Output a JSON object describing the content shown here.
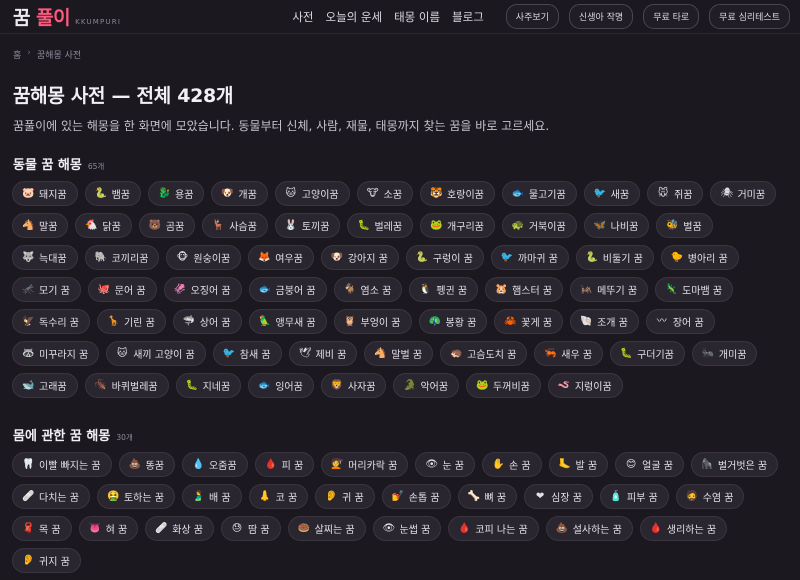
{
  "header": {
    "logo_text": "꿈",
    "logo_accent": "풀이",
    "logo_sub": "KKUMPURI",
    "links": [
      "사전",
      "오늘의 운세",
      "태몽 이름",
      "블로그"
    ],
    "buttons": [
      "사주보기",
      "신생아 작명",
      "무료 타로",
      "무료 심리테스트"
    ]
  },
  "breadcrumb": {
    "home": "홈",
    "sep": "›",
    "current": "꿈해몽 사전"
  },
  "page": {
    "title": "꿈해몽 사전 — 전체 428개",
    "description": "꿈풀이에 있는 해몽을 한 화면에 모았습니다. 동물부터 신체, 사람, 재물, 태몽까지 찾는 꿈을 바로 고르세요."
  },
  "sections": [
    {
      "title": "동물 꿈 해몽",
      "count": "65개",
      "items": [
        {
          "icon": "🐷",
          "label": "돼지꿈"
        },
        {
          "icon": "🐍",
          "label": "뱀꿈"
        },
        {
          "icon": "🐉",
          "label": "용꿈"
        },
        {
          "icon": "🐶",
          "label": "개꿈"
        },
        {
          "icon": "🐱",
          "label": "고양이꿈"
        },
        {
          "icon": "🐮",
          "label": "소꿈"
        },
        {
          "icon": "🐯",
          "label": "호랑이꿈"
        },
        {
          "icon": "🐟",
          "label": "물고기꿈"
        },
        {
          "icon": "🐦",
          "label": "새꿈"
        },
        {
          "icon": "🐭",
          "label": "쥐꿈"
        },
        {
          "icon": "🕷",
          "label": "거미꿈"
        },
        {
          "icon": "🐴",
          "label": "말꿈"
        },
        {
          "icon": "🐔",
          "label": "닭꿈"
        },
        {
          "icon": "🐻",
          "label": "곰꿈"
        },
        {
          "icon": "🦌",
          "label": "사슴꿈"
        },
        {
          "icon": "🐰",
          "label": "토끼꿈"
        },
        {
          "icon": "🐛",
          "label": "벌레꿈"
        },
        {
          "icon": "🐸",
          "label": "개구리꿈"
        },
        {
          "icon": "🐢",
          "label": "거북이꿈"
        },
        {
          "icon": "🦋",
          "label": "나비꿈"
        },
        {
          "icon": "🐝",
          "label": "벌꿈"
        },
        {
          "icon": "🐺",
          "label": "늑대꿈"
        },
        {
          "icon": "🐘",
          "label": "코끼리꿈"
        },
        {
          "icon": "🐵",
          "label": "원숭이꿈"
        },
        {
          "icon": "🦊",
          "label": "여우꿈"
        },
        {
          "icon": "🐶",
          "label": "강아지 꿈"
        },
        {
          "icon": "🐍",
          "label": "구렁이 꿈"
        },
        {
          "icon": "🐦",
          "label": "까마귀 꿈"
        },
        {
          "icon": "🐍",
          "label": "비둘기 꿈"
        },
        {
          "icon": "🐤",
          "label": "병아리 꿈"
        },
        {
          "icon": "🦟",
          "label": "모기 꿈"
        },
        {
          "icon": "🐙",
          "label": "문어 꿈"
        },
        {
          "icon": "🦑",
          "label": "오징어 꿈"
        },
        {
          "icon": "🐟",
          "label": "금붕어 꿈"
        },
        {
          "icon": "🐐",
          "label": "염소 꿈"
        },
        {
          "icon": "🐧",
          "label": "펭귄 꿈"
        },
        {
          "icon": "🐹",
          "label": "햄스터 꿈"
        },
        {
          "icon": "🦗",
          "label": "메뚜기 꿈"
        },
        {
          "icon": "🦎",
          "label": "도마뱀 꿈"
        },
        {
          "icon": "🦅",
          "label": "독수리 꿈"
        },
        {
          "icon": "🦒",
          "label": "기린 꿈"
        },
        {
          "icon": "🦈",
          "label": "상어 꿈"
        },
        {
          "icon": "🦜",
          "label": "앵무새 꿈"
        },
        {
          "icon": "🦉",
          "label": "부엉이 꿈"
        },
        {
          "icon": "🦚",
          "label": "봉황 꿈"
        },
        {
          "icon": "🦀",
          "label": "꽃게 꿈"
        },
        {
          "icon": "🐚",
          "label": "조개 꿈"
        },
        {
          "icon": "〰",
          "label": "장어 꿈"
        },
        {
          "icon": "🦝",
          "label": "미꾸라지 꿈"
        },
        {
          "icon": "🐱",
          "label": "새끼 고양이 꿈"
        },
        {
          "icon": "🐦",
          "label": "참새 꿈"
        },
        {
          "icon": "🕊",
          "label": "제비 꿈"
        },
        {
          "icon": "🐴",
          "label": "말벌 꿈"
        },
        {
          "icon": "🦔",
          "label": "고슴도치 꿈"
        },
        {
          "icon": "🦐",
          "label": "새우 꿈"
        },
        {
          "icon": "🐛",
          "label": "구더기꿈"
        },
        {
          "icon": "🐜",
          "label": "개미꿈"
        },
        {
          "icon": "🐋",
          "label": "고래꿈"
        },
        {
          "icon": "🪳",
          "label": "바퀴벌레꿈"
        },
        {
          "icon": "🐛",
          "label": "지네꿈"
        },
        {
          "icon": "🐟",
          "label": "잉어꿈"
        },
        {
          "icon": "🦁",
          "label": "사자꿈"
        },
        {
          "icon": "🐊",
          "label": "악어꿈"
        },
        {
          "icon": "🐸",
          "label": "두꺼비꿈"
        },
        {
          "icon": "🪱",
          "label": "지렁이꿈"
        }
      ]
    },
    {
      "title": "몸에 관한 꿈 해몽",
      "count": "30개",
      "items": [
        {
          "icon": "🦷",
          "label": "이빨 빠지는 꿈"
        },
        {
          "icon": "💩",
          "label": "똥꿈"
        },
        {
          "icon": "💧",
          "label": "오줌꿈"
        },
        {
          "icon": "🩸",
          "label": "피 꿈"
        },
        {
          "icon": "💇",
          "label": "머리카락 꿈"
        },
        {
          "icon": "👁",
          "label": "눈 꿈"
        },
        {
          "icon": "✋",
          "label": "손 꿈"
        },
        {
          "icon": "🦶",
          "label": "발 꿈"
        },
        {
          "icon": "😊",
          "label": "얼굴 꿈"
        },
        {
          "icon": "🦍",
          "label": "벌거벗은 꿈"
        },
        {
          "icon": "🩹",
          "label": "다치는 꿈"
        },
        {
          "icon": "🤮",
          "label": "토하는 꿈"
        },
        {
          "icon": "🫃",
          "label": "배 꿈"
        },
        {
          "icon": "👃",
          "label": "코 꿈"
        },
        {
          "icon": "👂",
          "label": "귀 꿈"
        },
        {
          "icon": "💅",
          "label": "손톱 꿈"
        },
        {
          "icon": "🦴",
          "label": "뼈 꿈"
        },
        {
          "icon": "❤",
          "label": "심장 꿈"
        },
        {
          "icon": "🧴",
          "label": "피부 꿈"
        },
        {
          "icon": "🧔",
          "label": "수염 꿈"
        },
        {
          "icon": "🧣",
          "label": "목 꿈"
        },
        {
          "icon": "👅",
          "label": "혀 꿈"
        },
        {
          "icon": "🩹",
          "label": "화상 꿈"
        },
        {
          "icon": "😓",
          "label": "땀 꿈"
        },
        {
          "icon": "🍩",
          "label": "살찌는 꿈"
        },
        {
          "icon": "👁",
          "label": "눈썹 꿈"
        },
        {
          "icon": "🩸",
          "label": "코피 나는 꿈"
        },
        {
          "icon": "💩",
          "label": "설사하는 꿈"
        },
        {
          "icon": "🩸",
          "label": "생리하는 꿈"
        },
        {
          "icon": "👂",
          "label": "귀지 꿈"
        }
      ]
    }
  ]
}
